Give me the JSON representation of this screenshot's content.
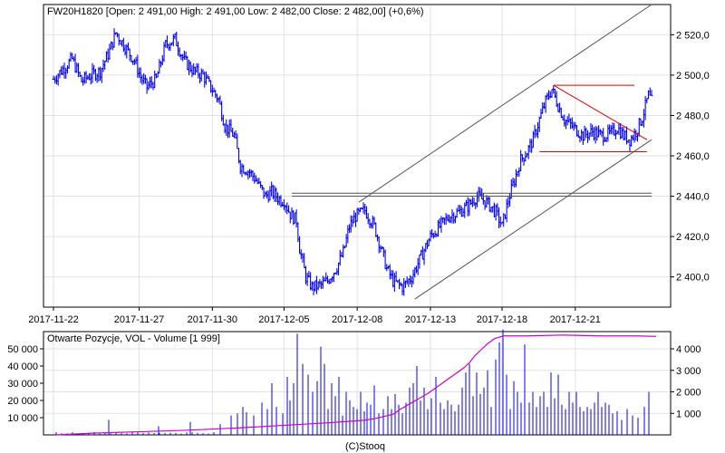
{
  "header": {
    "price_title": "FW20H1820 [Open: 2 491,00  High: 2 491,00  Low: 2 482,00  Close: 2 482,00] (+0,6%)",
    "volume_title": "Otwarte Pozycje, VOL - Volume [1 999]",
    "footer": "(C)Stooq"
  },
  "colors": {
    "price": "#0000ff",
    "volume": "#0000ff",
    "open_interest": "#cc00cc",
    "channel": "#555555",
    "triangle": "#dd0000",
    "grid": "#e2e2e2"
  },
  "chart_data": [
    {
      "type": "ohlc",
      "name": "price",
      "ylim": [
        2385,
        2535
      ],
      "y_ticks": [
        "2 400,0",
        "2 420,0",
        "2 440,0",
        "2 460,0",
        "2 480,0",
        "2 500,0",
        "2 520,0"
      ],
      "y_tick_values": [
        2400,
        2420,
        2440,
        2460,
        2480,
        2500,
        2520
      ],
      "x_ticks": [
        "2017-11-22",
        "2017-11-27",
        "2017-11-30",
        "2017-12-05",
        "2017-12-08",
        "2017-12-13",
        "2017-12-18",
        "2017-12-21"
      ],
      "x_tick_index": [
        0,
        55,
        102,
        148,
        195,
        242,
        288,
        335
      ],
      "bar_count": 385,
      "anchors": [
        [
          0,
          2498
        ],
        [
          6,
          2503
        ],
        [
          12,
          2508
        ],
        [
          18,
          2497
        ],
        [
          24,
          2500
        ],
        [
          30,
          2502
        ],
        [
          36,
          2512
        ],
        [
          40,
          2521
        ],
        [
          46,
          2514
        ],
        [
          52,
          2507
        ],
        [
          56,
          2499
        ],
        [
          60,
          2494
        ],
        [
          66,
          2498
        ],
        [
          72,
          2515
        ],
        [
          78,
          2518
        ],
        [
          84,
          2507
        ],
        [
          90,
          2502
        ],
        [
          96,
          2500
        ],
        [
          100,
          2495
        ],
        [
          106,
          2488
        ],
        [
          110,
          2475
        ],
        [
          116,
          2470
        ],
        [
          120,
          2455
        ],
        [
          126,
          2452
        ],
        [
          130,
          2448
        ],
        [
          136,
          2440
        ],
        [
          140,
          2442
        ],
        [
          146,
          2438
        ],
        [
          148,
          2438
        ],
        [
          152,
          2431
        ],
        [
          156,
          2428
        ],
        [
          158,
          2414
        ],
        [
          162,
          2400
        ],
        [
          166,
          2395
        ],
        [
          172,
          2396
        ],
        [
          176,
          2398
        ],
        [
          182,
          2405
        ],
        [
          186,
          2412
        ],
        [
          190,
          2425
        ],
        [
          194,
          2430
        ],
        [
          200,
          2433
        ],
        [
          206,
          2425
        ],
        [
          210,
          2415
        ],
        [
          214,
          2404
        ],
        [
          218,
          2398
        ],
        [
          224,
          2395
        ],
        [
          230,
          2400
        ],
        [
          236,
          2410
        ],
        [
          242,
          2420
        ],
        [
          248,
          2425
        ],
        [
          254,
          2430
        ],
        [
          260,
          2432
        ],
        [
          266,
          2435
        ],
        [
          272,
          2440
        ],
        [
          278,
          2437
        ],
        [
          284,
          2432
        ],
        [
          288,
          2425
        ],
        [
          292,
          2438
        ],
        [
          296,
          2448
        ],
        [
          300,
          2458
        ],
        [
          304,
          2462
        ],
        [
          308,
          2468
        ],
        [
          312,
          2478
        ],
        [
          316,
          2487
        ],
        [
          320,
          2493
        ],
        [
          324,
          2485
        ],
        [
          328,
          2478
        ],
        [
          334,
          2474
        ],
        [
          340,
          2470
        ],
        [
          346,
          2472
        ],
        [
          352,
          2470
        ],
        [
          358,
          2471
        ],
        [
          362,
          2474
        ],
        [
          366,
          2470
        ],
        [
          370,
          2468
        ],
        [
          374,
          2472
        ],
        [
          378,
          2479
        ],
        [
          382,
          2490
        ],
        [
          384,
          2487
        ]
      ],
      "channel_lines": [
        {
          "from": [
            196,
            2437
          ],
          "to": [
            384,
            2535
          ]
        },
        {
          "from": [
            232,
            2389
          ],
          "to": [
            384,
            2468
          ]
        }
      ],
      "support_lines": [
        {
          "from": [
            153,
            2441.5
          ],
          "to": [
            384,
            2441.5
          ]
        },
        {
          "from": [
            153,
            2440
          ],
          "to": [
            384,
            2440
          ]
        }
      ],
      "triangle_lines": [
        {
          "from": [
            321,
            2495
          ],
          "to": [
            373,
            2495
          ]
        },
        {
          "from": [
            312,
            2462
          ],
          "to": [
            381,
            2462
          ]
        },
        {
          "from": [
            321,
            2495
          ],
          "to": [
            381,
            2468
          ]
        }
      ]
    },
    {
      "type": "bar",
      "name": "volume",
      "ylim": [
        0,
        4800
      ],
      "y_ticks": [
        "1 000",
        "2 000",
        "3 000",
        "4 000"
      ],
      "y_tick_values": [
        1000,
        2000,
        3000,
        4000
      ],
      "spikes": [
        [
          120,
          700
        ],
        [
          175,
          400
        ],
        [
          210,
          600
        ],
        [
          243,
          500
        ],
        [
          255,
          900
        ],
        [
          262,
          1000
        ],
        [
          268,
          1300
        ],
        [
          272,
          1050
        ],
        [
          280,
          900
        ],
        [
          289,
          1500
        ],
        [
          295,
          1200
        ],
        [
          300,
          2400
        ],
        [
          305,
          1300
        ],
        [
          312,
          1000
        ],
        [
          317,
          2700
        ],
        [
          320,
          1600
        ],
        [
          324,
          2400
        ],
        [
          328,
          4700
        ],
        [
          334,
          3300
        ],
        [
          340,
          2800
        ],
        [
          345,
          2000
        ],
        [
          350,
          2500
        ],
        [
          354,
          4100
        ],
        [
          358,
          3300
        ],
        [
          362,
          1200
        ],
        [
          366,
          2400
        ],
        [
          370,
          1800
        ],
        [
          374,
          2700
        ],
        [
          378,
          900
        ],
        [
          382,
          2000
        ],
        [
          386,
          1600
        ],
        [
          390,
          1300
        ],
        [
          394,
          1200
        ],
        [
          398,
          2000
        ],
        [
          402,
          1100
        ],
        [
          405,
          1500
        ],
        [
          409,
          1400
        ],
        [
          413,
          2300
        ],
        [
          418,
          1000
        ],
        [
          423,
          1200
        ],
        [
          428,
          1800
        ],
        [
          432,
          1200
        ],
        [
          436,
          1900
        ],
        [
          440,
          1400
        ],
        [
          444,
          1000
        ],
        [
          448,
          1500
        ],
        [
          452,
          2200
        ],
        [
          456,
          2400
        ],
        [
          460,
          3200
        ],
        [
          464,
          1600
        ],
        [
          468,
          2200
        ],
        [
          472,
          1200
        ],
        [
          476,
          1700
        ],
        [
          481,
          2700
        ],
        [
          486,
          1500
        ],
        [
          490,
          1200
        ],
        [
          494,
          1600
        ],
        [
          498,
          1400
        ],
        [
          502,
          1100
        ],
        [
          506,
          1400
        ],
        [
          510,
          2200
        ],
        [
          514,
          2900
        ],
        [
          518,
          3300
        ],
        [
          522,
          1800
        ],
        [
          526,
          2900
        ],
        [
          530,
          1900
        ],
        [
          534,
          2200
        ],
        [
          538,
          3000
        ],
        [
          542,
          1300
        ],
        [
          547,
          3500
        ],
        [
          551,
          4300
        ],
        [
          555,
          4900
        ],
        [
          559,
          2800
        ],
        [
          563,
          1200
        ],
        [
          567,
          2500
        ],
        [
          571,
          2000
        ],
        [
          575,
          1500
        ],
        [
          579,
          4200
        ],
        [
          584,
          1500
        ],
        [
          588,
          2000
        ],
        [
          592,
          1300
        ],
        [
          596,
          1800
        ],
        [
          600,
          2000
        ],
        [
          604,
          1300
        ],
        [
          608,
          2900
        ],
        [
          612,
          1700
        ],
        [
          616,
          2800
        ],
        [
          620,
          1400
        ],
        [
          624,
          1200
        ],
        [
          628,
          2000
        ],
        [
          632,
          1500
        ],
        [
          636,
          2000
        ],
        [
          640,
          1300
        ],
        [
          644,
          1100
        ],
        [
          648,
          1300
        ],
        [
          652,
          1200
        ],
        [
          656,
          1500
        ],
        [
          660,
          2000
        ],
        [
          664,
          1300
        ],
        [
          668,
          1500
        ],
        [
          672,
          1400
        ],
        [
          676,
          1000
        ],
        [
          681,
          1100
        ],
        [
          686,
          700
        ],
        [
          692,
          1200
        ],
        [
          698,
          900
        ],
        [
          704,
          800
        ],
        [
          711,
          1300
        ],
        [
          716,
          2000
        ]
      ]
    },
    {
      "type": "line",
      "name": "open_interest",
      "ylim": [
        0,
        60000
      ],
      "y_ticks": [
        "10 000",
        "20 000",
        "30 000",
        "40 000",
        "50 000"
      ],
      "y_tick_values": [
        10000,
        20000,
        30000,
        40000,
        50000
      ],
      "points": [
        [
          0,
          0
        ],
        [
          40,
          1000
        ],
        [
          90,
          1800
        ],
        [
          140,
          2600
        ],
        [
          200,
          4000
        ],
        [
          250,
          5500
        ],
        [
          300,
          7000
        ],
        [
          340,
          8500
        ],
        [
          352,
          9500
        ],
        [
          360,
          10500
        ],
        [
          372,
          12000
        ],
        [
          380,
          15000
        ],
        [
          390,
          18000
        ],
        [
          400,
          21000
        ],
        [
          410,
          24000
        ],
        [
          418,
          27000
        ],
        [
          426,
          30000
        ],
        [
          434,
          33000
        ],
        [
          442,
          36000
        ],
        [
          450,
          39000
        ],
        [
          456,
          42000
        ],
        [
          462,
          46000
        ],
        [
          470,
          50000
        ],
        [
          476,
          53000
        ],
        [
          484,
          56000
        ],
        [
          494,
          57500
        ],
        [
          520,
          57500
        ],
        [
          560,
          58000
        ],
        [
          600,
          57500
        ],
        [
          640,
          57500
        ],
        [
          662,
          57200
        ]
      ]
    }
  ]
}
